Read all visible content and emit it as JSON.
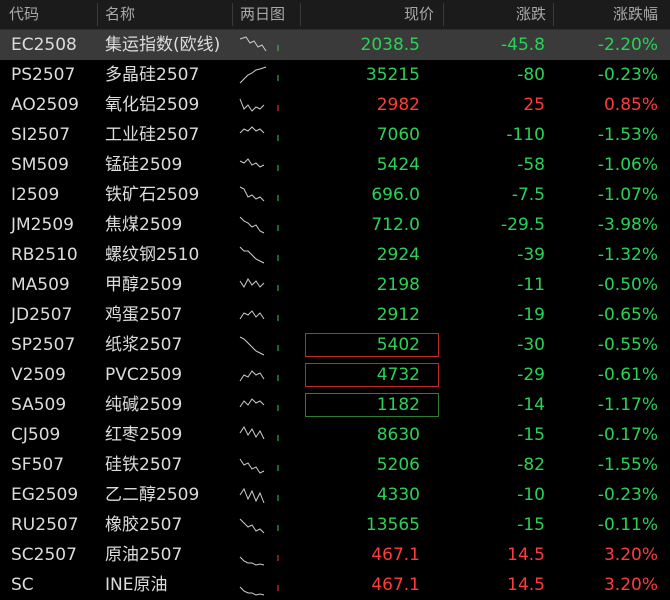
{
  "colors": {
    "up": "#ff3b3b",
    "down": "#2bd156",
    "neutral": "#dcdcdc",
    "selected_row_bg": "#3a3a3a"
  },
  "headers": {
    "code": "代码",
    "name": "名称",
    "spark": "两日图",
    "price": "现价",
    "change": "涨跌",
    "pct": "涨跌幅"
  },
  "rows": [
    {
      "code": "EC2508",
      "name": "集运指数(欧线)",
      "price": "2038.5",
      "change": "-45.8",
      "pct": "-2.20%",
      "dir": "dn",
      "price_dir": "dn",
      "selected": true
    },
    {
      "code": "PS2507",
      "name": "多晶硅2507",
      "price": "35215",
      "change": "-80",
      "pct": "-0.23%",
      "dir": "dn",
      "price_dir": "dn"
    },
    {
      "code": "AO2509",
      "name": "氧化铝2509",
      "price": "2982",
      "change": "25",
      "pct": "0.85%",
      "dir": "up",
      "price_dir": "up"
    },
    {
      "code": "SI2507",
      "name": "工业硅2507",
      "price": "7060",
      "change": "-110",
      "pct": "-1.53%",
      "dir": "dn",
      "price_dir": "dn"
    },
    {
      "code": "SM509",
      "name": "锰硅2509",
      "price": "5424",
      "change": "-58",
      "pct": "-1.06%",
      "dir": "dn",
      "price_dir": "dn"
    },
    {
      "code": "I2509",
      "name": "铁矿石2509",
      "price": "696.0",
      "change": "-7.5",
      "pct": "-1.07%",
      "dir": "dn",
      "price_dir": "dn"
    },
    {
      "code": "JM2509",
      "name": "焦煤2509",
      "price": "712.0",
      "change": "-29.5",
      "pct": "-3.98%",
      "dir": "dn",
      "price_dir": "dn"
    },
    {
      "code": "RB2510",
      "name": "螺纹钢2510",
      "price": "2924",
      "change": "-39",
      "pct": "-1.32%",
      "dir": "dn",
      "price_dir": "dn"
    },
    {
      "code": "MA509",
      "name": "甲醇2509",
      "price": "2198",
      "change": "-11",
      "pct": "-0.50%",
      "dir": "dn",
      "price_dir": "dn"
    },
    {
      "code": "JD2507",
      "name": "鸡蛋2507",
      "price": "2912",
      "change": "-19",
      "pct": "-0.65%",
      "dir": "dn",
      "price_dir": "dn"
    },
    {
      "code": "SP2507",
      "name": "纸浆2507",
      "price": "5402",
      "change": "-30",
      "pct": "-0.55%",
      "dir": "dn",
      "price_dir": "dn",
      "flash": "r"
    },
    {
      "code": "V2509",
      "name": "PVC2509",
      "price": "4732",
      "change": "-29",
      "pct": "-0.61%",
      "dir": "dn",
      "price_dir": "dn",
      "flash": "r"
    },
    {
      "code": "SA509",
      "name": "纯碱2509",
      "price": "1182",
      "change": "-14",
      "pct": "-1.17%",
      "dir": "dn",
      "price_dir": "dn",
      "flash": "g"
    },
    {
      "code": "CJ509",
      "name": "红枣2509",
      "price": "8630",
      "change": "-15",
      "pct": "-0.17%",
      "dir": "dn",
      "price_dir": "dn"
    },
    {
      "code": "SF507",
      "name": "硅铁2507",
      "price": "5206",
      "change": "-82",
      "pct": "-1.55%",
      "dir": "dn",
      "price_dir": "dn"
    },
    {
      "code": "EG2509",
      "name": "乙二醇2509",
      "price": "4330",
      "change": "-10",
      "pct": "-0.23%",
      "dir": "dn",
      "price_dir": "dn"
    },
    {
      "code": "RU2507",
      "name": "橡胶2507",
      "price": "13565",
      "change": "-15",
      "pct": "-0.11%",
      "dir": "dn",
      "price_dir": "dn"
    },
    {
      "code": "SC2507",
      "name": "原油2507",
      "price": "467.1",
      "change": "14.5",
      "pct": "3.20%",
      "dir": "up",
      "price_dir": "up"
    },
    {
      "code": "SC",
      "name": "INE原油",
      "price": "467.1",
      "change": "14.5",
      "pct": "3.20%",
      "dir": "up",
      "price_dir": "up"
    }
  ]
}
